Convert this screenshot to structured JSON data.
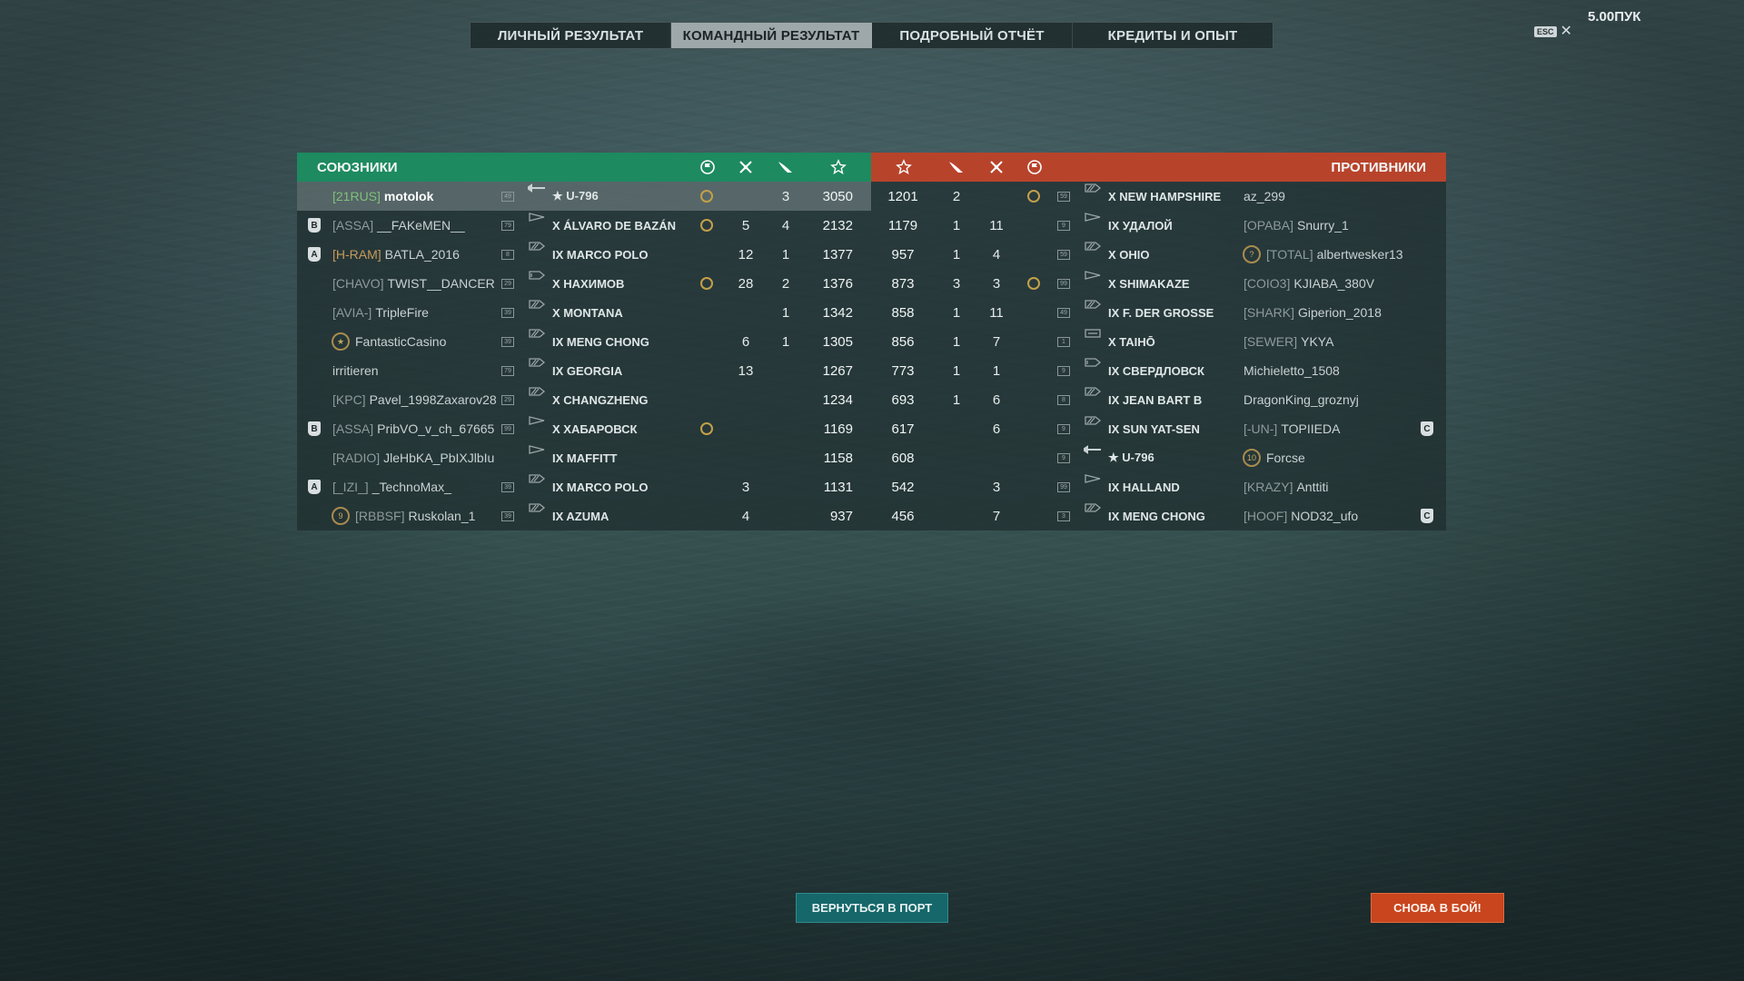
{
  "version": "5.00ПУК",
  "esc": {
    "key": "ESC",
    "close": "✕"
  },
  "tabs": [
    "ЛИЧНЫЙ РЕЗУЛЬТАТ",
    "КОМАНДНЫЙ РЕЗУЛЬТАТ",
    "ПОДРОБНЫЙ ОТЧЁТ",
    "КРЕДИТЫ И ОПЫТ"
  ],
  "active_tab": 1,
  "allies": {
    "title": "СОЮЗНИКИ",
    "rows": [
      {
        "badge": "",
        "clan": "[21RUS]",
        "clan_color": "g",
        "name": "motolok",
        "lvl": "49",
        "ship": "★ U-796",
        "flag": true,
        "kills": "",
        "planes": "3",
        "xp": "3050",
        "me": true,
        "cls": "sub"
      },
      {
        "badge": "B",
        "clan": "[ASSA]",
        "clan_color": "",
        "name": "__FAKeMEN__",
        "lvl": "79",
        "ship": "X ÁLVARO DE BAZÁN",
        "flag": true,
        "kills": "5",
        "planes": "4",
        "xp": "2132",
        "cls": "dd"
      },
      {
        "badge": "A",
        "clan": "[H-RAM]",
        "clan_color": "o",
        "name": "BATLA_2016",
        "lvl": "8",
        "ship": "IX MARCO POLO",
        "flag": false,
        "kills": "12",
        "planes": "1",
        "xp": "1377",
        "cls": "bb"
      },
      {
        "badge": "",
        "clan": "[CHAVO]",
        "clan_color": "",
        "name": "TWIST__DANCER",
        "lvl": "29",
        "ship": "X НАХИМОВ",
        "flag": true,
        "kills": "28",
        "planes": "2",
        "xp": "1376",
        "cls": "ca"
      },
      {
        "badge": "",
        "clan": "[AVIA-]",
        "clan_color": "",
        "name": "TripleFire",
        "lvl": "39",
        "ship": "X MONTANA",
        "flag": false,
        "kills": "",
        "planes": "1",
        "xp": "1342",
        "cls": "bb"
      },
      {
        "badge": "",
        "clan": "",
        "clan_color": "",
        "name": "FantasticCasino",
        "lvl": "39",
        "ship": "IX MENG CHONG",
        "flag": false,
        "kills": "6",
        "planes": "1",
        "xp": "1305",
        "cls": "bb",
        "medal": "★"
      },
      {
        "badge": "",
        "clan": "",
        "clan_color": "",
        "name": "irritieren",
        "lvl": "79",
        "ship": "IX GEORGIA",
        "flag": false,
        "kills": "13",
        "planes": "",
        "xp": "1267",
        "cls": "bb"
      },
      {
        "badge": "",
        "clan": "[KPC]",
        "clan_color": "",
        "name": "Pavel_1998Zaxarov28",
        "lvl": "29",
        "ship": "X CHANGZHENG",
        "flag": false,
        "kills": "",
        "planes": "",
        "xp": "1234",
        "cls": "bb"
      },
      {
        "badge": "B",
        "clan": "[ASSA]",
        "clan_color": "",
        "name": "PribVO_v_ch_67665",
        "lvl": "99",
        "ship": "X ХАБАРОВСК",
        "flag": true,
        "kills": "",
        "planes": "",
        "xp": "1169",
        "cls": "dd"
      },
      {
        "badge": "",
        "clan": "[RADIO]",
        "clan_color": "",
        "name": "JleHbKA_PbIXJlbIu",
        "lvl": "",
        "ship": "IX MAFFITT",
        "flag": false,
        "kills": "",
        "planes": "",
        "xp": "1158",
        "cls": "dd"
      },
      {
        "badge": "A",
        "clan": "[_IZI_]",
        "clan_color": "",
        "name": "_TechnoMax_",
        "lvl": "39",
        "ship": "IX MARCO POLO",
        "flag": false,
        "kills": "3",
        "planes": "",
        "xp": "1131",
        "cls": "bb"
      },
      {
        "badge": "",
        "clan": "[RBBSF]",
        "clan_color": "",
        "name": "Ruskolan_1",
        "lvl": "39",
        "ship": "IX AZUMA",
        "flag": false,
        "kills": "4",
        "planes": "",
        "xp": "937",
        "cls": "bb",
        "medal": "9"
      }
    ]
  },
  "enemies": {
    "title": "ПРОТИВНИКИ",
    "rows": [
      {
        "xp": "1201",
        "planes": "2",
        "kills": "",
        "flag": true,
        "lvl": "59",
        "ship": "X NEW HAMPSHIRE",
        "clan": "",
        "name": "az_299",
        "badge": "",
        "cls": "bb"
      },
      {
        "xp": "1179",
        "planes": "1",
        "kills": "11",
        "flag": false,
        "lvl": "9",
        "ship": "IX УДАЛОЙ",
        "clan": "[OPABA]",
        "name": "Snurry_1",
        "badge": "",
        "cls": "dd"
      },
      {
        "xp": "957",
        "planes": "1",
        "kills": "4",
        "flag": false,
        "lvl": "59",
        "ship": "X OHIO",
        "clan": "[TOTAL]",
        "name": "albertwesker13",
        "badge": "",
        "cls": "bb",
        "medal": "?"
      },
      {
        "xp": "873",
        "planes": "3",
        "kills": "3",
        "flag": true,
        "lvl": "99",
        "ship": "X SHIMAKAZE",
        "clan": "[COIO3]",
        "name": "KJIABA_380V",
        "badge": "",
        "cls": "dd"
      },
      {
        "xp": "858",
        "planes": "1",
        "kills": "11",
        "flag": false,
        "lvl": "49",
        "ship": "IX F. DER GROSSE",
        "clan": "[SHARK]",
        "name": "Giperion_2018",
        "badge": "",
        "cls": "bb"
      },
      {
        "xp": "856",
        "planes": "1",
        "kills": "7",
        "flag": false,
        "lvl": "1",
        "ship": "X TAIHŌ",
        "clan": "[SEWER]",
        "name": "YKYA",
        "badge": "",
        "cls": "cv"
      },
      {
        "xp": "773",
        "planes": "1",
        "kills": "1",
        "flag": false,
        "lvl": "9",
        "ship": "IX СВЕРДЛОВСК",
        "clan": "",
        "name": "Michieletto_1508",
        "badge": "",
        "cls": "ca"
      },
      {
        "xp": "693",
        "planes": "1",
        "kills": "6",
        "flag": false,
        "lvl": "8",
        "ship": "IX JEAN BART B",
        "clan": "",
        "name": "DragonKing_groznyj",
        "badge": "",
        "cls": "bb"
      },
      {
        "xp": "617",
        "planes": "",
        "kills": "6",
        "flag": false,
        "lvl": "9",
        "ship": "IX SUN YAT-SEN",
        "clan": "[-UN-]",
        "name": "TOPIIEDA",
        "badge": "C",
        "cls": "bb"
      },
      {
        "xp": "608",
        "planes": "",
        "kills": "",
        "flag": false,
        "lvl": "9",
        "ship": "★ U-796",
        "clan": "",
        "name": "Forcse",
        "badge": "",
        "cls": "sub",
        "medal": "10"
      },
      {
        "xp": "542",
        "planes": "",
        "kills": "3",
        "flag": false,
        "lvl": "99",
        "ship": "IX HALLAND",
        "clan": "[KRAZY]",
        "name": "Anttiti",
        "badge": "",
        "cls": "dd"
      },
      {
        "xp": "456",
        "planes": "",
        "kills": "7",
        "flag": false,
        "lvl": "3",
        "ship": "IX MENG CHONG",
        "clan": "[HOOF]",
        "name": "NOD32_ufo",
        "badge": "C",
        "cls": "bb"
      }
    ]
  },
  "icons": {
    "flag": "base-capture-icon",
    "kills": "ribbon-icon",
    "planes": "plane-icon",
    "xp": "star-icon"
  },
  "colors": {
    "allies": "#1d8a60",
    "enemies": "#b8432b",
    "port_button": "#16676a",
    "battle_button": "#c8451e"
  },
  "buttons": {
    "port": "ВЕРНУТЬСЯ В ПОРТ",
    "battle": "СНОВА В БОЙ!"
  }
}
